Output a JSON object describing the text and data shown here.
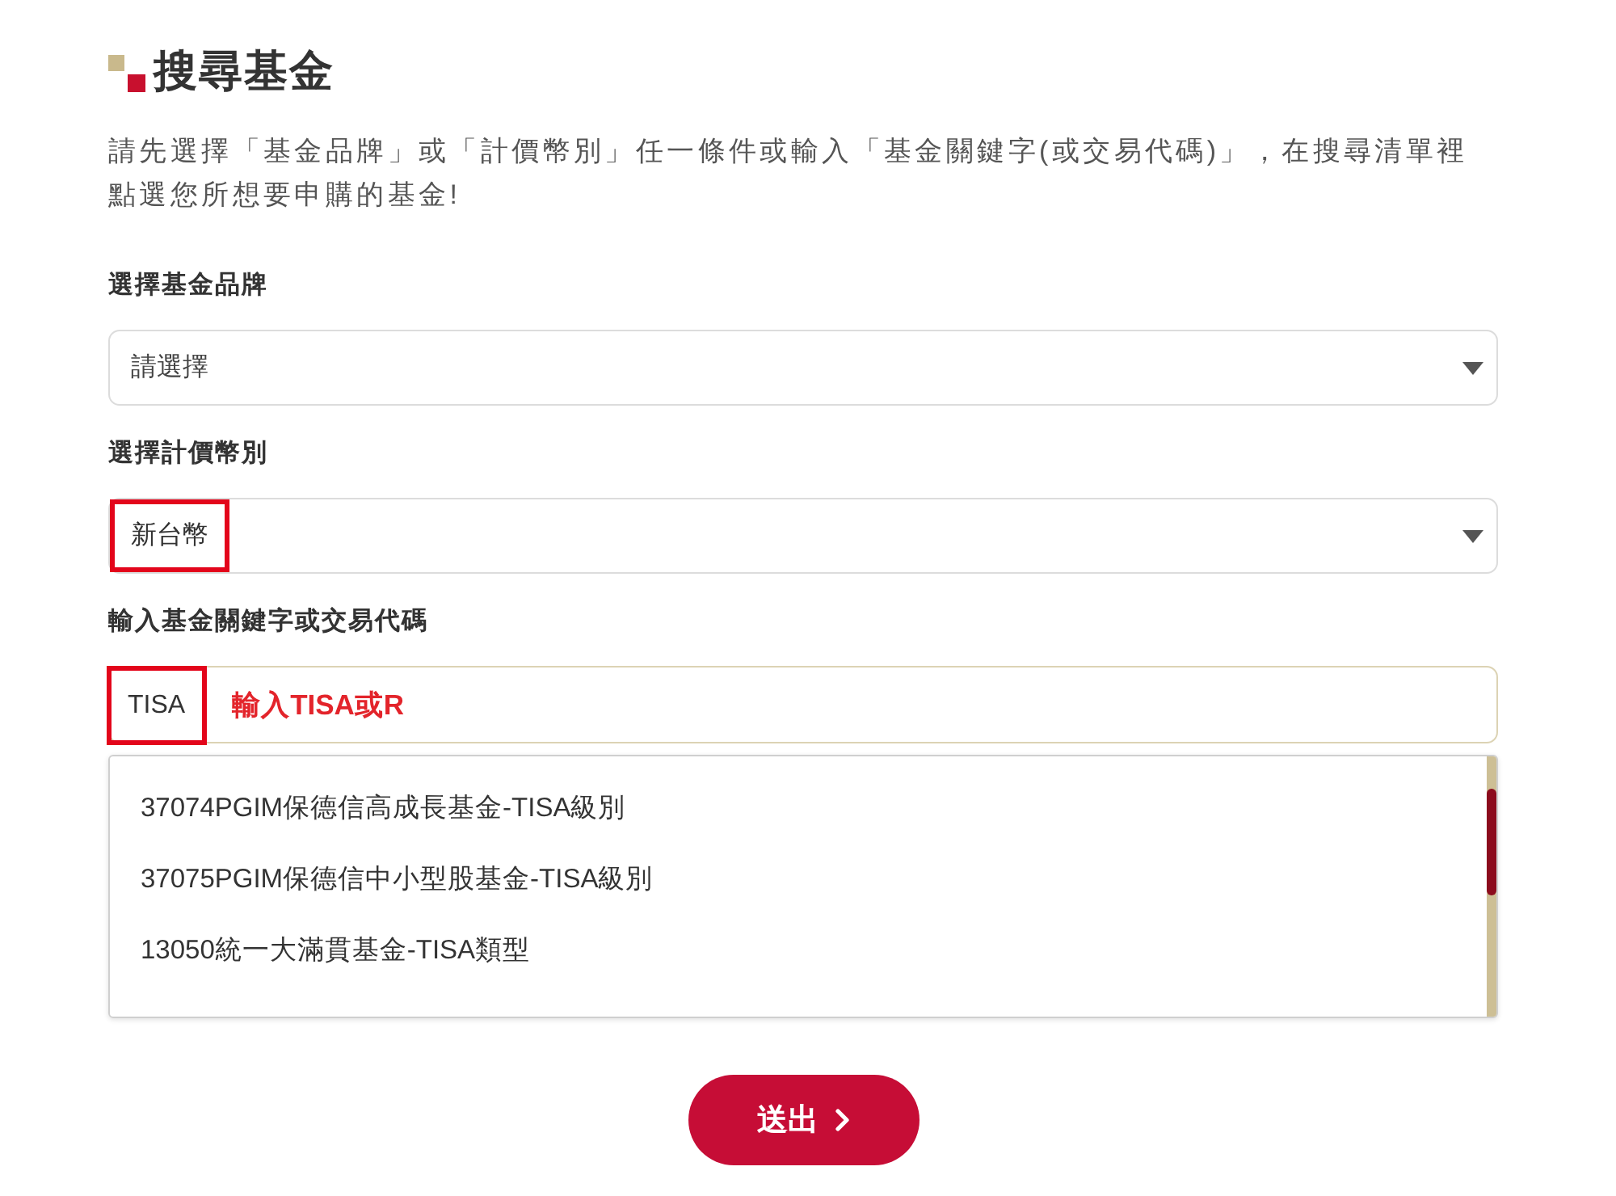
{
  "heading": {
    "title": "搜尋基金"
  },
  "intro": "請先選擇「基金品牌」或「計價幣別」任一條件或輸入「基金關鍵字(或交易代碼)」，在搜尋清單裡點選您所想要申購的基金!",
  "fields": [
    {
      "kind": "select",
      "label": "選擇基金品牌",
      "placeholder": "請選擇",
      "highlighted": false
    },
    {
      "kind": "select",
      "label": "選擇計價幣別",
      "value": "新台幣",
      "highlighted": true
    },
    {
      "kind": "search",
      "label": "輸入基金關鍵字或交易代碼",
      "value": "TISA",
      "highlighted": true,
      "focused": true,
      "note": "輸入TISA或R",
      "suggestions": [
        "37074PGIM保德信高成長基金-TISA級別",
        "37075PGIM保德信中小型股基金-TISA級別",
        "13050統一大滿貫基金-TISA類型"
      ]
    }
  ],
  "submit": {
    "label": "送出"
  }
}
